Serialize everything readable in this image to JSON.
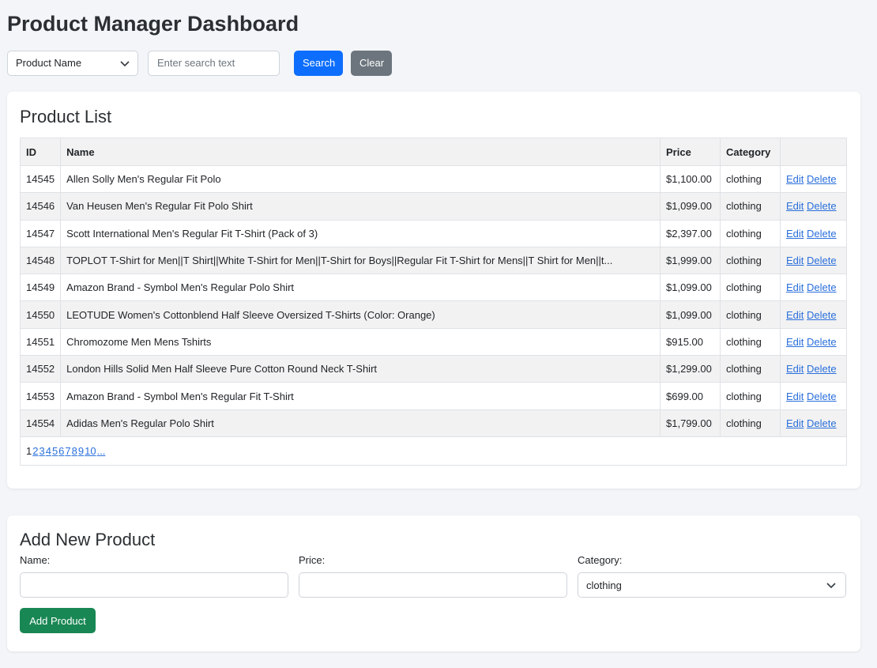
{
  "page": {
    "title": "Product Manager Dashboard"
  },
  "search": {
    "field_selected": "Product Name",
    "placeholder": "Enter search text",
    "value": "",
    "search_label": "Search",
    "clear_label": "Clear"
  },
  "list": {
    "title": "Product List",
    "headers": {
      "id": "ID",
      "name": "Name",
      "price": "Price",
      "category": "Category",
      "actions": ""
    },
    "edit_label": "Edit",
    "delete_label": "Delete",
    "rows": [
      {
        "id": "14545",
        "name": "Allen Solly Men's Regular Fit Polo",
        "price": "$1,100.00",
        "category": "clothing"
      },
      {
        "id": "14546",
        "name": "Van Heusen Men's Regular Fit Polo Shirt",
        "price": "$1,099.00",
        "category": "clothing"
      },
      {
        "id": "14547",
        "name": "Scott International Men's Regular Fit T-Shirt (Pack of 3)",
        "price": "$2,397.00",
        "category": "clothing"
      },
      {
        "id": "14548",
        "name": "TOPLOT T-Shirt for Men||T Shirt||White T-Shirt for Men||T-Shirt for Boys||Regular Fit T-Shirt for Mens||T Shirt for Men||t...",
        "price": "$1,999.00",
        "category": "clothing"
      },
      {
        "id": "14549",
        "name": "Amazon Brand - Symbol Men's Regular Polo Shirt",
        "price": "$1,099.00",
        "category": "clothing"
      },
      {
        "id": "14550",
        "name": "LEOTUDE Women's Cottonblend Half Sleeve Oversized T-Shirts (Color: Orange)",
        "price": "$1,099.00",
        "category": "clothing"
      },
      {
        "id": "14551",
        "name": "Chromozome Men Mens Tshirts",
        "price": "$915.00",
        "category": "clothing"
      },
      {
        "id": "14552",
        "name": "London Hills Solid Men Half Sleeve Pure Cotton Round Neck T-Shirt",
        "price": "$1,299.00",
        "category": "clothing"
      },
      {
        "id": "14553",
        "name": "Amazon Brand - Symbol Men's Regular Fit T-Shirt",
        "price": "$699.00",
        "category": "clothing"
      },
      {
        "id": "14554",
        "name": "Adidas Men's Regular Polo Shirt",
        "price": "$1,799.00",
        "category": "clothing"
      }
    ],
    "pagination": {
      "current": "1",
      "pages": [
        "2",
        "3",
        "4",
        "5",
        "6",
        "7",
        "8",
        "9",
        "10",
        "..."
      ]
    }
  },
  "form": {
    "title": "Add New Product",
    "name_label": "Name:",
    "name_value": "",
    "price_label": "Price:",
    "price_value": "",
    "category_label": "Category:",
    "category_value": "clothing",
    "submit_label": "Add Product"
  },
  "colors": {
    "primary": "#0d6efd",
    "secondary": "#6c757d",
    "success": "#198754",
    "link": "#2a6fdb",
    "background": "#f3f5f8"
  },
  "icons": {
    "select_arrow": "chevron-down-icon"
  }
}
